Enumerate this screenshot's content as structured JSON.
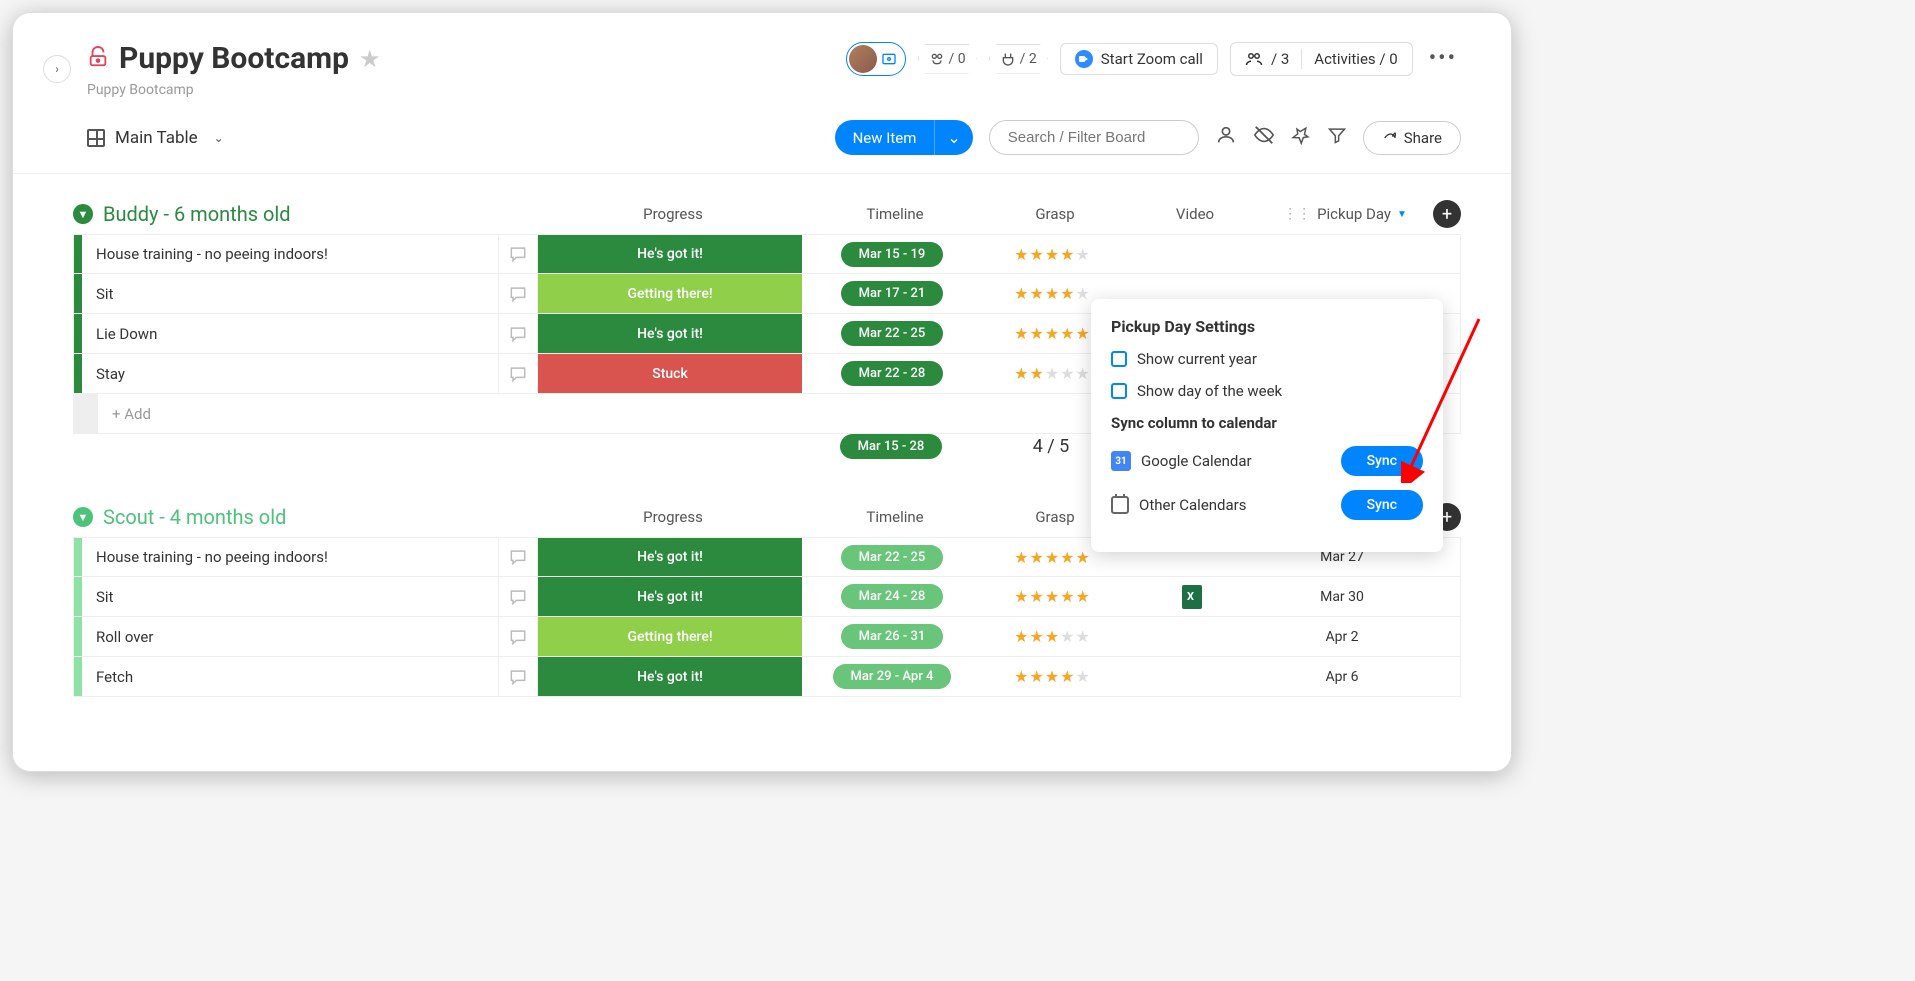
{
  "header": {
    "title": "Puppy Bootcamp",
    "subtitle": "Puppy Bootcamp",
    "automations": "/ 0",
    "integrations": "/ 2",
    "zoom_label": "Start Zoom call",
    "people": "/ 3",
    "activities_label": "Activities / 0"
  },
  "toolbar": {
    "view_label": "Main Table",
    "new_item_label": "New Item",
    "search_placeholder": "Search / Filter Board",
    "share_label": "Share"
  },
  "columns": {
    "progress": "Progress",
    "timeline": "Timeline",
    "grasp": "Grasp",
    "video": "Video",
    "pickup": "Pickup Day"
  },
  "groups": [
    {
      "name": "Buddy - 6 months old",
      "color": "#2b8a3e",
      "bar": "#2b8a3e",
      "rows": [
        {
          "name": "House training - no peeing indoors!",
          "progress": "He's got it!",
          "pcolor": "#2b8a3e",
          "timeline": "Mar 15 - 19",
          "tlight": false,
          "grasp": 4,
          "video": "",
          "pickup": ""
        },
        {
          "name": "Sit",
          "progress": "Getting there!",
          "pcolor": "#8fcf4a",
          "timeline": "Mar 17 - 21",
          "tlight": false,
          "grasp": 4,
          "video": "",
          "pickup": ""
        },
        {
          "name": "Lie Down",
          "progress": "He's got it!",
          "pcolor": "#2b8a3e",
          "timeline": "Mar 22 - 25",
          "tlight": false,
          "grasp": 5,
          "video": "",
          "pickup": ""
        },
        {
          "name": "Stay",
          "progress": "Stuck",
          "pcolor": "#d9534f",
          "timeline": "Mar 22 - 28",
          "tlight": false,
          "grasp": 2,
          "video": "",
          "pickup": ""
        }
      ],
      "add_label": "+ Add",
      "summary_timeline": "Mar 15 - 28",
      "summary_grasp": "4 / 5"
    },
    {
      "name": "Scout - 4 months old",
      "color": "#4cc27b",
      "bar": "#8fe2a6",
      "rows": [
        {
          "name": "House training - no peeing indoors!",
          "progress": "He's got it!",
          "pcolor": "#2b8a3e",
          "timeline": "Mar 22 - 25",
          "tlight": true,
          "grasp": 5,
          "video": "",
          "pickup": "Mar 27"
        },
        {
          "name": "Sit",
          "progress": "He's got it!",
          "pcolor": "#2b8a3e",
          "timeline": "Mar 24 - 28",
          "tlight": true,
          "grasp": 5,
          "video": "excel",
          "pickup": "Mar 30"
        },
        {
          "name": "Roll over",
          "progress": "Getting there!",
          "pcolor": "#8fcf4a",
          "timeline": "Mar 26 - 31",
          "tlight": true,
          "grasp": 3,
          "video": "",
          "pickup": "Apr 2"
        },
        {
          "name": "Fetch",
          "progress": "He's got it!",
          "pcolor": "#2b8a3e",
          "timeline": "Mar 29 - Apr 4",
          "tlight": true,
          "grasp": 4,
          "video": "",
          "pickup": "Apr 6"
        }
      ]
    }
  ],
  "popup": {
    "title": "Pickup Day Settings",
    "opt1": "Show current year",
    "opt2": "Show day of the week",
    "sync_header": "Sync column to calendar",
    "gcal": "Google Calendar",
    "other": "Other Calendars",
    "sync_btn": "Sync"
  }
}
